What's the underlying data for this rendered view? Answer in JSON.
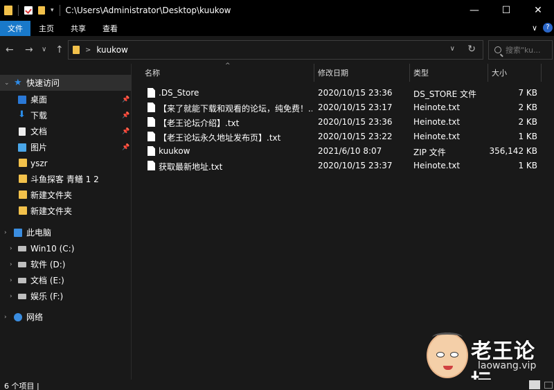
{
  "title_bar": {
    "path": "C:\\Users\\Administrator\\Desktop\\kuukow",
    "qa_dropdown": "▾",
    "minimize": "—",
    "maximize": "☐",
    "close": "✕"
  },
  "ribbon": {
    "tabs": [
      "文件",
      "主页",
      "共享",
      "查看"
    ],
    "expand_glyph": "∨",
    "help_glyph": "?"
  },
  "nav": {
    "back": "←",
    "forward": "→",
    "recent": "∨",
    "up": "↑"
  },
  "address": {
    "crumb_sep": ">",
    "crumb": "kuukow",
    "dropdown": "∨",
    "refresh": "↻"
  },
  "search": {
    "placeholder": "搜索\"ku..."
  },
  "nav_pane": {
    "quick_access": "快速访问",
    "pinned": [
      {
        "label": "桌面",
        "icon": "desktop-icon"
      },
      {
        "label": "下载",
        "icon": "download-icon"
      },
      {
        "label": "文档",
        "icon": "document-icon"
      },
      {
        "label": "图片",
        "icon": "pictures-icon"
      }
    ],
    "recent": [
      "yszr",
      "斗鱼探客 青鳝 1 2",
      "新建文件夹",
      "新建文件夹"
    ],
    "this_pc": "此电脑",
    "drives": [
      "Win10 (C:)",
      "软件 (D:)",
      "文档 (E:)",
      "娱乐 (F:)"
    ],
    "network": "网络",
    "pin_glyph": "📌"
  },
  "columns": {
    "name": "名称",
    "modified": "修改日期",
    "type": "类型",
    "size": "大小",
    "sort_glyph": "^"
  },
  "files": [
    {
      "name": ".DS_Store",
      "modified": "2020/10/15 23:36",
      "type": "DS_STORE 文件",
      "size": "7 KB"
    },
    {
      "name": "【来了就能下载和观看的论坛，纯免费！...",
      "modified": "2020/10/15 23:17",
      "type": "Heinote.txt",
      "size": "2 KB"
    },
    {
      "name": "【老王论坛介绍】.txt",
      "modified": "2020/10/15 23:36",
      "type": "Heinote.txt",
      "size": "2 KB"
    },
    {
      "name": "【老王论坛永久地址发布页】.txt",
      "modified": "2020/10/15 23:22",
      "type": "Heinote.txt",
      "size": "1 KB"
    },
    {
      "name": "kuukow",
      "modified": "2021/6/10 8:07",
      "type": "ZIP 文件",
      "size": "356,142 KB"
    },
    {
      "name": "获取最新地址.txt",
      "modified": "2020/10/15 23:37",
      "type": "Heinote.txt",
      "size": "1 KB"
    }
  ],
  "status": {
    "count": "6 个项目  |"
  },
  "watermark": {
    "title": "老王论坛",
    "url": "laowang.vip"
  },
  "colors": {
    "accent": "#1979ca",
    "folder": "#f2c14b",
    "background": "#191919"
  }
}
